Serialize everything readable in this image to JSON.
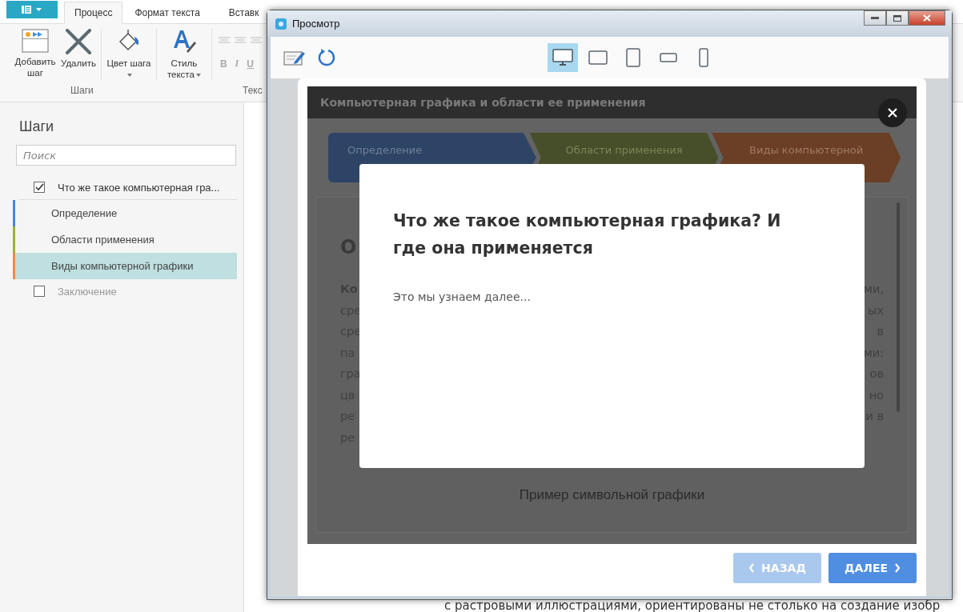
{
  "ribbon": {
    "tabs": [
      {
        "label": "Процесс",
        "selected": true
      },
      {
        "label": "Формат текста",
        "selected": false
      },
      {
        "label": "Вставк",
        "selected": false
      }
    ],
    "buttons": [
      {
        "label": "Добавить шаг",
        "kind": "add",
        "dropdown": false
      },
      {
        "label": "Удалить",
        "kind": "delete",
        "dropdown": false
      },
      {
        "label": "Цвет шага",
        "kind": "color",
        "dropdown": true
      },
      {
        "label": "Стиль текста",
        "kind": "style",
        "dropdown": true
      }
    ],
    "format_buttons": [
      "B",
      "I",
      "U"
    ],
    "group_labels": [
      "Шаги",
      "Текс"
    ]
  },
  "steps_panel": {
    "title": "Шаги",
    "search": {
      "placeholder": "Поиск"
    },
    "items": [
      {
        "label": "Что же такое компьютерная гра...",
        "checked": true,
        "children": [
          {
            "label": "Определение",
            "color": "#4a86d8",
            "selected": false
          },
          {
            "label": "Области применения",
            "color": "#9ab13a",
            "selected": false
          },
          {
            "label": "Виды компьютерной графики",
            "color": "#f08a4b",
            "selected": true
          }
        ]
      },
      {
        "label": "Заключение",
        "checked": false
      }
    ]
  },
  "preview": {
    "title": "Просмотр",
    "devices": [
      {
        "kind": "desktop",
        "selected": true
      },
      {
        "kind": "tablet-landscape",
        "selected": false
      },
      {
        "kind": "tablet-portrait",
        "selected": false
      },
      {
        "kind": "phone-landscape",
        "selected": false
      },
      {
        "kind": "phone-portrait",
        "selected": false
      }
    ],
    "lesson": {
      "title": "Компьютерная графика и области ее применения",
      "steps": [
        {
          "label": "Определение",
          "color": "#2d4466"
        },
        {
          "label": "Области применения",
          "color": "#474f2a"
        },
        {
          "label": "Виды компьютерной",
          "color": "#6a3f25"
        }
      ],
      "heading": "О",
      "lines": [
        {
          "left": "Ко",
          "right": "ми,"
        },
        {
          "left": "сре",
          "right": "ых"
        },
        {
          "left": "сре",
          "right": "в"
        },
        {
          "left": "па",
          "right": "ми:"
        },
        {
          "left": "гра",
          "right": "ов"
        },
        {
          "left": "цв",
          "right": "но"
        },
        {
          "left": "ре",
          "right": "и в"
        },
        {
          "left": "ре"
        }
      ],
      "caption": "Пример символьной графики"
    },
    "modal": {
      "title": "Что же такое компьютерная графика? И где она применяется",
      "text": "Это мы узнаем далее..."
    },
    "buttons": [
      {
        "label": "НАЗАД",
        "kind": "back",
        "disabled": true
      },
      {
        "label": "ДАЛЕЕ",
        "kind": "next",
        "disabled": false
      }
    ]
  },
  "background_text": "с растровыми иллюстрациями, ориентированы не столько на создание изобр"
}
